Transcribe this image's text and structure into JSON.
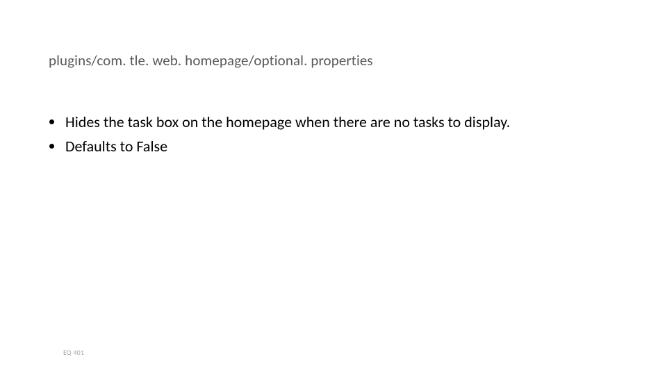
{
  "heading": "plugins/com. tle. web. homepage/optional. properties",
  "bullets": [
    "Hides the task box on the homepage when there are no tasks to display.",
    "Defaults to False"
  ],
  "footer": "EQ 401"
}
